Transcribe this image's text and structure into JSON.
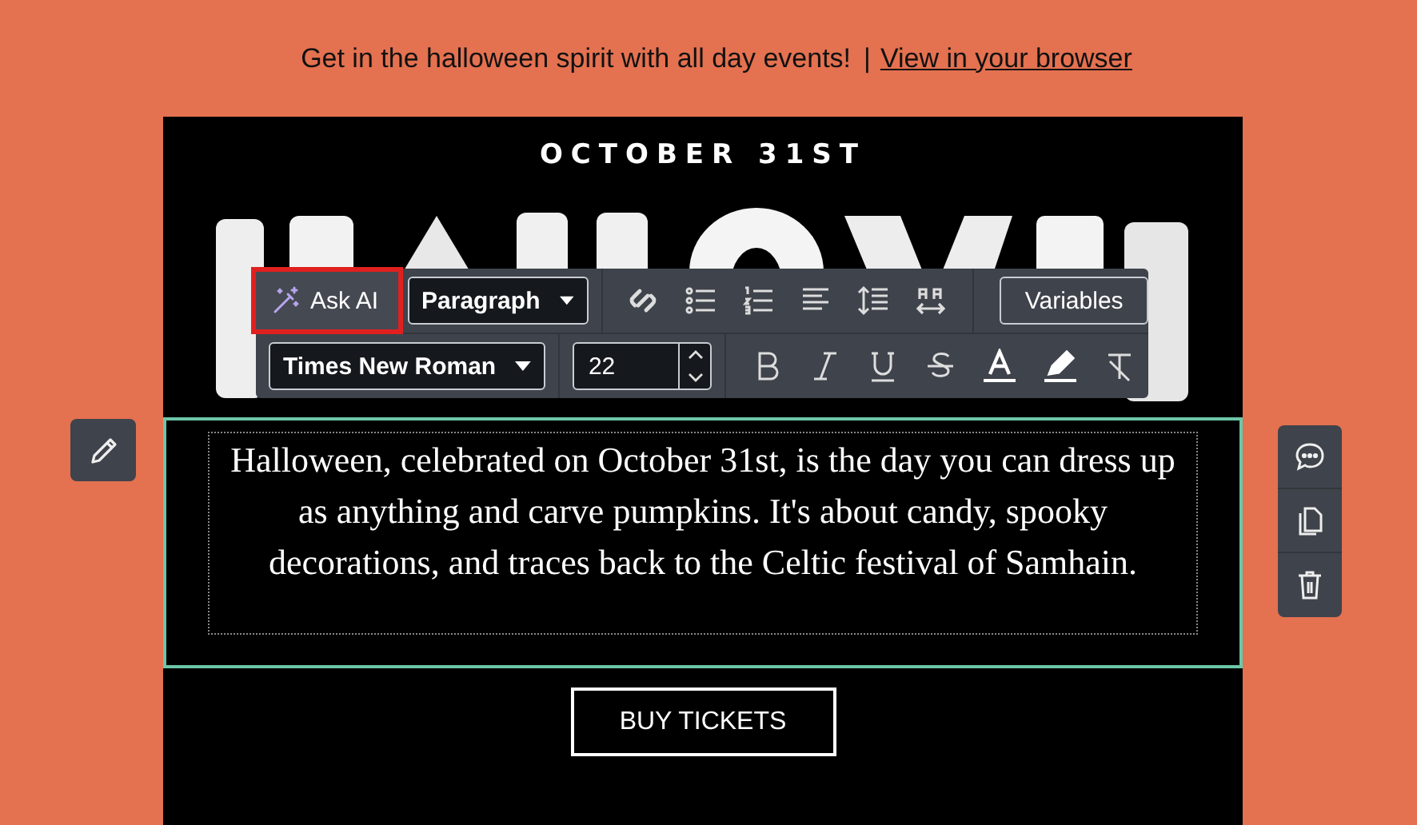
{
  "preheader": {
    "text": "Get in the halloween spirit with all day events!",
    "separator": "|",
    "link": "View in your browser"
  },
  "email": {
    "date": "OCTOBER 31ST",
    "paragraph": "Halloween, celebrated on October 31st, is the day you can dress up as anything and carve pumpkins. It's about candy, spooky decorations, and traces back to the Celtic festival of Samhain.",
    "paragraph_selected": true,
    "button": "BUY TICKETS"
  },
  "toolbar": {
    "ask_ai": {
      "label": "Ask AI",
      "highlighted": true
    },
    "block_format": "Paragraph",
    "variables": "Variables",
    "font_family": "Times New Roman",
    "font_size": "22"
  }
}
